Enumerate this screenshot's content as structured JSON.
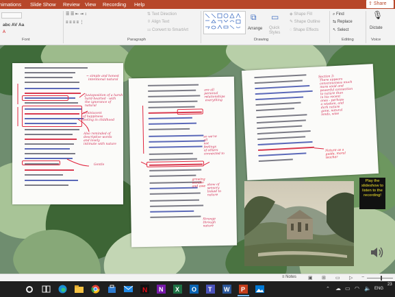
{
  "tabs": [
    "Animations",
    "Slide Show",
    "Review",
    "View",
    "Recording",
    "Help"
  ],
  "share_label": "Share",
  "ribbon": {
    "font_group": "Font",
    "paragraph_group": "Paragraph",
    "drawing_group": "Drawing",
    "editing_group": "Editing",
    "voice_group": "Voice",
    "text_direction": "Text Direction",
    "align_text": "Align Text",
    "convert_smartart": "Convert to SmartArt",
    "arrange": "Arrange",
    "quick_styles": "Quick Styles",
    "shape_fill": "Shape Fill",
    "shape_outline": "Shape Outline",
    "shape_effects": "Shape Effects",
    "find": "Find",
    "replace": "Replace",
    "select": "Select",
    "dictate": "Dictate"
  },
  "slide": {
    "play_note": "Play the slideshow to listen to the recording!"
  },
  "status": {
    "notes": "Notes"
  },
  "taskbar": {
    "lang": "ENG",
    "clock": "23"
  }
}
